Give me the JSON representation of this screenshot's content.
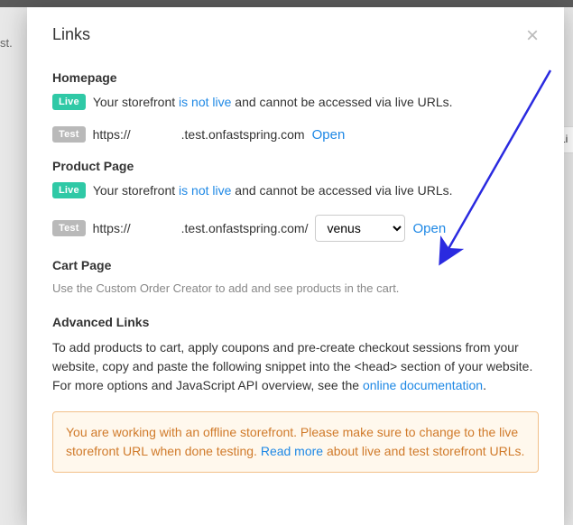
{
  "bg": {
    "left_fragment": "st.",
    "right_btn": "Li"
  },
  "modal": {
    "title": "Links"
  },
  "badges": {
    "live": "Live",
    "test": "Test"
  },
  "homepage": {
    "heading": "Homepage",
    "pre": "Your storefront ",
    "not_live": "is not live",
    "post": " and cannot be accessed via live URLs.",
    "scheme": "https://",
    "domain": ".test.onfastspring.com",
    "open": "Open"
  },
  "product": {
    "heading": "Product Page",
    "pre": "Your storefront ",
    "not_live": "is not live",
    "post": " and cannot be accessed via live URLs.",
    "scheme": "https://",
    "domain": ".test.onfastspring.com/",
    "select_value": "venus",
    "options": [
      "venus"
    ],
    "open": "Open"
  },
  "cart": {
    "heading": "Cart Page",
    "hint": "Use the Custom Order Creator to add and see products in the cart."
  },
  "advanced": {
    "heading": "Advanced Links",
    "p1": "To add products to cart, apply coupons and pre-create checkout sessions from your website, copy and paste the following snippet into the <head> section of your website. For more options and JavaScript API overview, see the ",
    "link": "online documentation",
    "p2": "."
  },
  "alert": {
    "t1": "You are working with an offline storefront. Please make sure to change to the live storefront URL when done testing. ",
    "link": "Read more",
    "t2": " about live and test storefront URLs."
  },
  "arrow_color": "#2a2ae0"
}
